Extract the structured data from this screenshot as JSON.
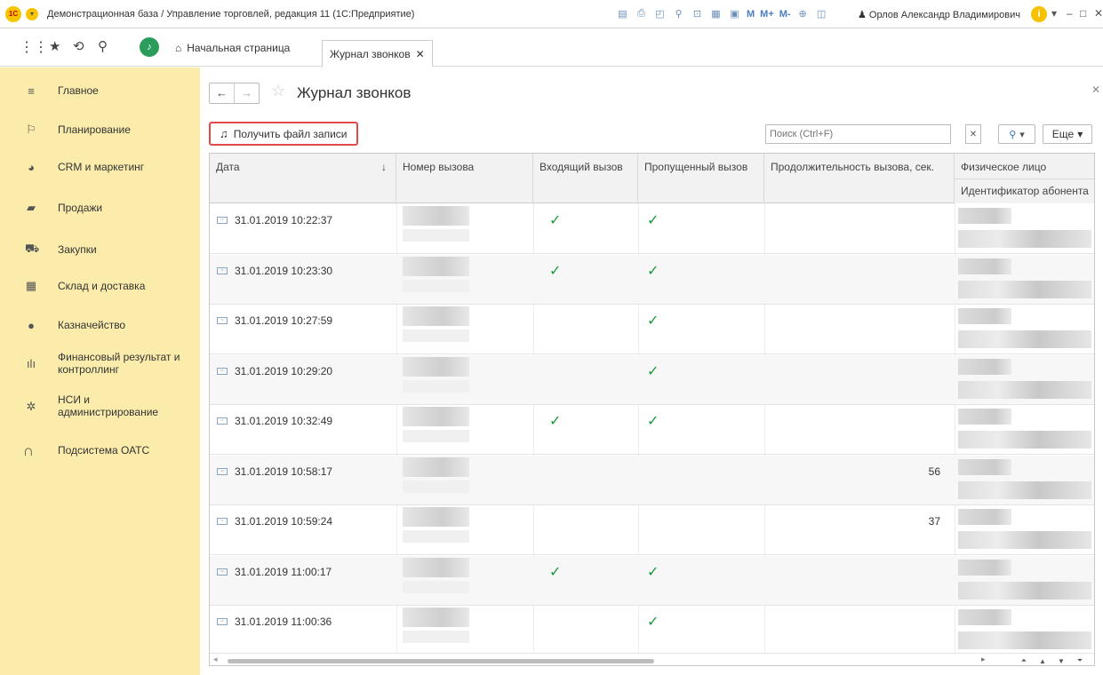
{
  "window": {
    "title": "Демонстрационная база / Управление торговлей, редакция 11  (1С:Предприятие)",
    "logo": "1С",
    "user_name": "Орлов Александр Владимирович",
    "memory_buttons": [
      "M",
      "M+",
      "M-"
    ]
  },
  "navbar": {
    "home_tab": "Начальная страница",
    "active_tab": "Журнал звонков"
  },
  "sidebar": {
    "items": [
      {
        "label": "Главное",
        "icon": "menu-lines-icon"
      },
      {
        "label": "Планирование",
        "icon": "planning-icon"
      },
      {
        "label": "CRM и маркетинг",
        "icon": "pie-icon"
      },
      {
        "label": "Продажи",
        "icon": "bag-icon"
      },
      {
        "label": "Закупки",
        "icon": "cart-icon"
      },
      {
        "label": "Склад и доставка",
        "icon": "warehouse-icon"
      },
      {
        "label": "Казначейство",
        "icon": "coin-icon"
      },
      {
        "label": "Финансовый результат и контроллинг",
        "icon": "bar-chart-icon"
      },
      {
        "label": "НСИ и администрирование",
        "icon": "gear-icon"
      },
      {
        "label": "Подсистема ОАТС",
        "icon": "headset-icon"
      }
    ]
  },
  "form": {
    "title": "Журнал звонков",
    "get_file_label": "Получить файл записи",
    "search_placeholder": "Поиск (Ctrl+F)",
    "more_label": "Еще"
  },
  "table": {
    "columns": [
      "Дата",
      "Номер вызова",
      "Входящий вызов",
      "Пропущенный вызов",
      "Продолжительность вызова, сек.",
      "Физическое лицо"
    ],
    "sub_column": "Идентификатор абонента",
    "sort_indicator": "↓",
    "rows": [
      {
        "date": "31.01.2019 10:22:37",
        "incoming": true,
        "missed": true,
        "duration": ""
      },
      {
        "date": "31.01.2019 10:23:30",
        "incoming": true,
        "missed": true,
        "duration": ""
      },
      {
        "date": "31.01.2019 10:27:59",
        "incoming": false,
        "missed": true,
        "duration": ""
      },
      {
        "date": "31.01.2019 10:29:20",
        "incoming": false,
        "missed": true,
        "duration": ""
      },
      {
        "date": "31.01.2019 10:32:49",
        "incoming": true,
        "missed": true,
        "duration": ""
      },
      {
        "date": "31.01.2019 10:58:17",
        "incoming": false,
        "missed": false,
        "duration": "56"
      },
      {
        "date": "31.01.2019 10:59:24",
        "incoming": false,
        "missed": false,
        "duration": "37"
      },
      {
        "date": "31.01.2019 11:00:17",
        "incoming": true,
        "missed": true,
        "duration": ""
      },
      {
        "date": "31.01.2019 11:00:36",
        "incoming": false,
        "missed": true,
        "duration": ""
      }
    ]
  },
  "colors": {
    "sidebar_bg": "#fbecac",
    "highlight_border": "#e14a4a",
    "check_green": "#1a9a3e"
  }
}
